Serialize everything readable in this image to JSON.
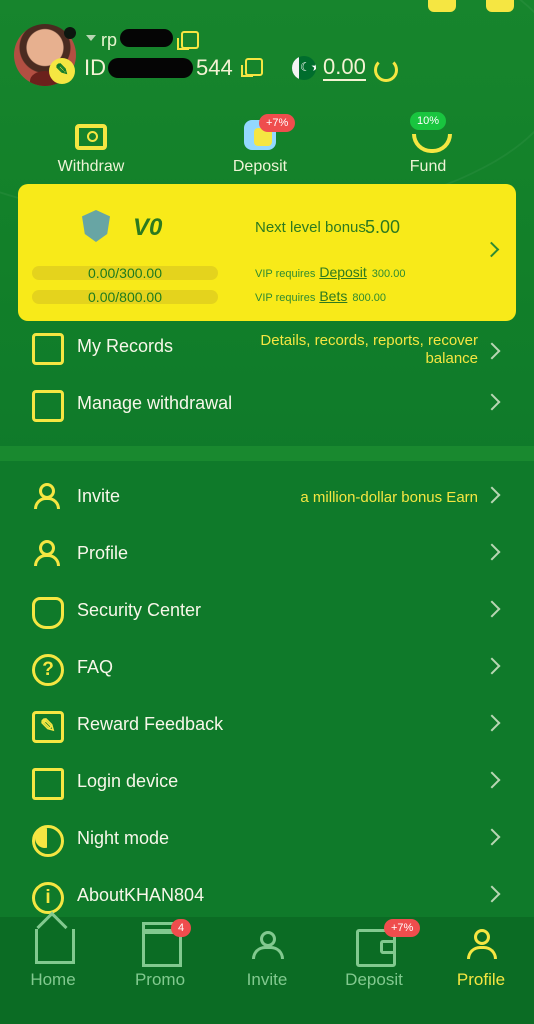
{
  "header": {
    "username": "rp",
    "user_id_prefix": "ID",
    "user_id_suffix": "544",
    "balance": "0.00"
  },
  "quick_actions": [
    {
      "label": "Withdraw"
    },
    {
      "label": "Deposit",
      "badge": "+7%"
    },
    {
      "label": "Fund",
      "badge": "10%"
    }
  ],
  "vip": {
    "level": "V0",
    "progress_1": "0.00/300.00",
    "progress_2": "0.00/800.00",
    "progress_1_fraction": 0,
    "progress_2_fraction": 0,
    "next_level_label": "Next level bonus",
    "next_level_value": "5.00",
    "deposit_prefix": "VIP requires",
    "deposit_link": "Deposit",
    "deposit_amount": "300.00",
    "bets_prefix": "VIP requires",
    "bets_link": "Bets",
    "bets_amount": "800.00"
  },
  "menu": {
    "records": {
      "label": "My Records",
      "desc_line1": "Details, records, reports, recover",
      "desc_line2": "balance"
    },
    "manage_withdrawal": {
      "label": "Manage withdrawal"
    },
    "invite": {
      "label": "Invite",
      "desc": "a million-dollar bonus  Earn"
    },
    "profile": {
      "label": "Profile"
    },
    "security": {
      "label": "Security Center"
    },
    "faq": {
      "label": "FAQ"
    },
    "feedback": {
      "label": "Reward Feedback"
    },
    "login_device": {
      "label": "Login device"
    },
    "night_mode": {
      "label": "Night mode"
    },
    "about": {
      "label": "AboutKHAN804"
    }
  },
  "bottom_nav": [
    {
      "label": "Home"
    },
    {
      "label": "Promo",
      "badge": "4"
    },
    {
      "label": "Invite"
    },
    {
      "label": "Deposit",
      "badge": "+7%"
    },
    {
      "label": "Profile"
    }
  ],
  "colors": {
    "background": "#0f7a2a",
    "accent_yellow": "#f5e642",
    "vip_card": "#f8ea19",
    "bottom_bar": "#0b6c24",
    "badge_red": "#ef4d4d"
  }
}
